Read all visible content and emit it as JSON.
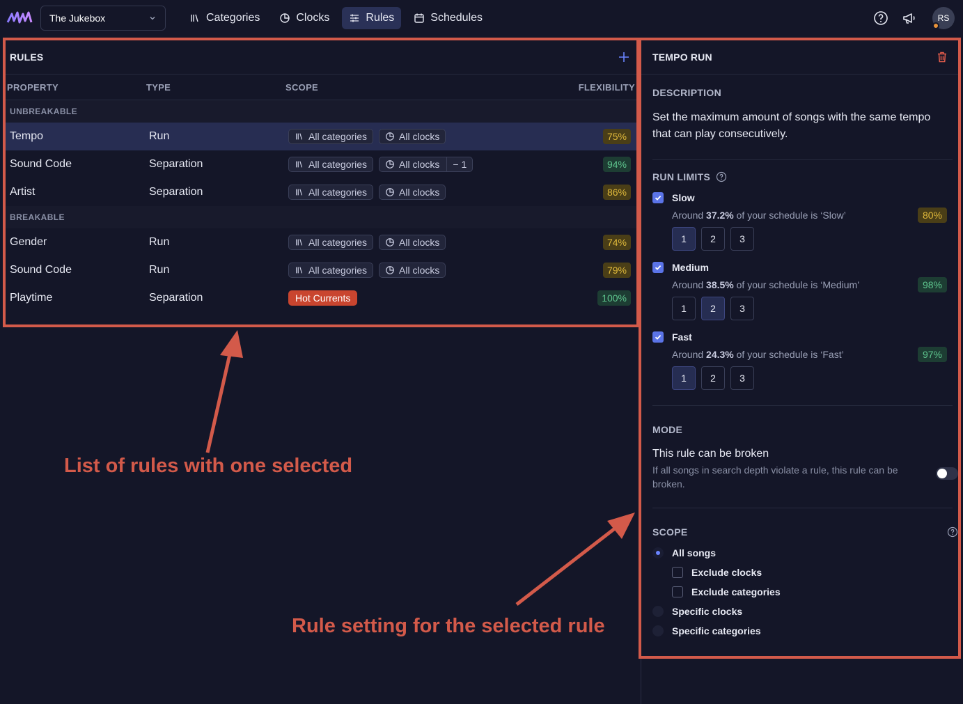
{
  "topbar": {
    "station": "The Jukebox",
    "nav": [
      {
        "label": "Categories",
        "icon": "library-icon",
        "active": false
      },
      {
        "label": "Clocks",
        "icon": "clock-icon",
        "active": false
      },
      {
        "label": "Rules",
        "icon": "sliders-icon",
        "active": true
      },
      {
        "label": "Schedules",
        "icon": "calendar-icon",
        "active": false
      }
    ],
    "avatar": "RS",
    "accent": "#2a3157"
  },
  "rules": {
    "title": "RULES",
    "columns": {
      "property": "PROPERTY",
      "type": "TYPE",
      "scope": "SCOPE",
      "flexibility": "FLEXIBILITY"
    },
    "groups": [
      {
        "label": "UNBREAKABLE",
        "rows": [
          {
            "property": "Tempo",
            "type": "Run",
            "categories": "All categories",
            "clocks": "All clocks",
            "clocks_extra": "",
            "flexibility": "75%",
            "flex_color": "yellow",
            "selected": true
          },
          {
            "property": "Sound Code",
            "type": "Separation",
            "categories": "All categories",
            "clocks": "All clocks",
            "clocks_extra": "− 1",
            "flexibility": "94%",
            "flex_color": "green",
            "selected": false
          },
          {
            "property": "Artist",
            "type": "Separation",
            "categories": "All categories",
            "clocks": "All clocks",
            "clocks_extra": "",
            "flexibility": "86%",
            "flex_color": "yellow",
            "selected": false
          }
        ]
      },
      {
        "label": "BREAKABLE",
        "rows": [
          {
            "property": "Gender",
            "type": "Run",
            "categories": "All categories",
            "clocks": "All clocks",
            "clocks_extra": "",
            "flexibility": "74%",
            "flex_color": "yellow",
            "selected": false
          },
          {
            "property": "Sound Code",
            "type": "Run",
            "categories": "All categories",
            "clocks": "All clocks",
            "clocks_extra": "",
            "flexibility": "79%",
            "flex_color": "yellow",
            "selected": false
          },
          {
            "property": "Playtime",
            "type": "Separation",
            "category_tag": "Hot Currents",
            "flexibility": "100%",
            "flex_color": "green",
            "selected": false
          }
        ]
      }
    ]
  },
  "settings": {
    "title": "TEMPO RUN",
    "description_title": "DESCRIPTION",
    "description": "Set the maximum amount of songs with the same tempo that can play consecutively.",
    "run_limits_title": "RUN LIMITS",
    "limits": [
      {
        "label": "Slow",
        "around": "Around",
        "share": "37.2%",
        "suffix": "of your schedule is ‘Slow’",
        "pct": "80%",
        "pct_color": "yellow",
        "selected_step": 1
      },
      {
        "label": "Medium",
        "around": "Around",
        "share": "38.5%",
        "suffix": "of your schedule is ‘Medium’",
        "pct": "98%",
        "pct_color": "green",
        "selected_step": 2
      },
      {
        "label": "Fast",
        "around": "Around",
        "share": "24.3%",
        "suffix": "of your schedule is ‘Fast’",
        "pct": "97%",
        "pct_color": "green",
        "selected_step": 1
      }
    ],
    "steps": [
      "1",
      "2",
      "3"
    ],
    "mode_title": "MODE",
    "mode_label": "This rule can be broken",
    "mode_desc": "If all songs in search depth violate a rule, this rule can be broken.",
    "mode_enabled": false,
    "scope_title": "SCOPE",
    "scope_options": {
      "all_songs": "All songs",
      "exclude_clocks": "Exclude clocks",
      "exclude_categories": "Exclude categories",
      "specific_clocks": "Specific clocks",
      "specific_categories": "Specific categories"
    },
    "scope_selected": "All songs"
  },
  "annotations": {
    "left": "List of rules with one selected",
    "right": "Rule setting for the selected rule",
    "color": "#d35a4a"
  }
}
